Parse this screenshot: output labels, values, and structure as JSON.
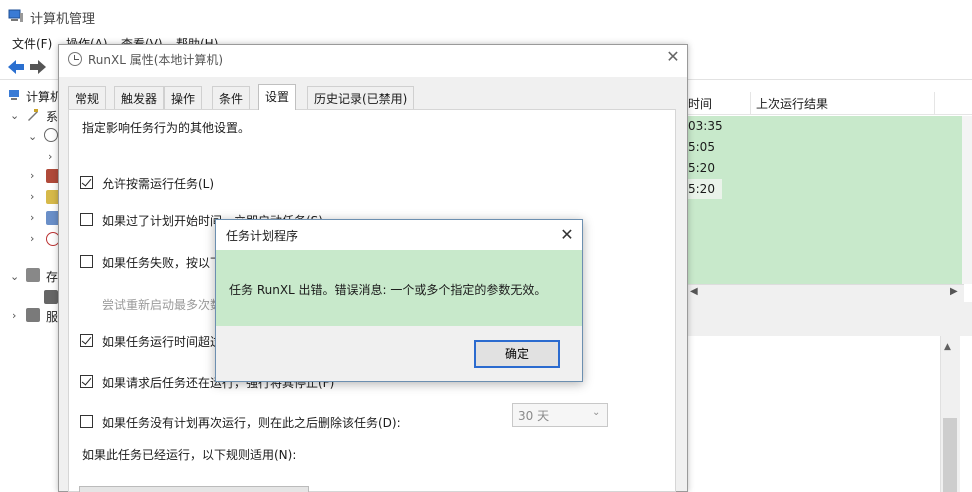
{
  "main_window": {
    "title": "计算机管理",
    "menu": [
      "文件(F)",
      "操作(A)",
      "查看(V)",
      "帮助(H)"
    ],
    "tree": {
      "root_label": "计算机",
      "system_tools": "系",
      "storage": "存",
      "services": "服"
    },
    "list": {
      "col_time": "时间",
      "col_result": "上次运行结果",
      "times": [
        "03:35",
        "5:05",
        "5:20",
        "5:20"
      ]
    }
  },
  "properties_dialog": {
    "title": "RunXL 属性(本地计算机)",
    "tabs": [
      "常规",
      "触发器",
      "操作",
      "条件",
      "设置",
      "历史记录(已禁用)"
    ],
    "active_tab": "设置",
    "intro": "指定影响任务行为的其他设置。",
    "options": {
      "allow_on_demand": "允许按需运行任务(L)",
      "run_after_missed": "如果过了计划开始时间，立即启动任务(S)",
      "restart_on_fail": "如果任务失败，按以下频率重新启动:",
      "restart_attempts": "尝试重新启动最多次数:",
      "stop_if_runs_longer": "如果任务运行时间超过以下时间，停止任务:",
      "force_stop": "如果请求后任务还在运行，强行将其停止(F)",
      "delete_if_not_scheduled": "如果任务没有计划再次运行，则在此之后删除该任务(D):",
      "rule_label": "如果此任务已经运行，以下规则适用(N):"
    },
    "delete_after_value": "30 天"
  },
  "message_box": {
    "title": "任务计划程序",
    "text": "任务 RunXL 出错。错误消息: 一个或多个指定的参数无效。",
    "ok_label": "确定"
  },
  "colors": {
    "highlight_green": "#c8e9cb",
    "focus_blue": "#2b6bcf"
  }
}
